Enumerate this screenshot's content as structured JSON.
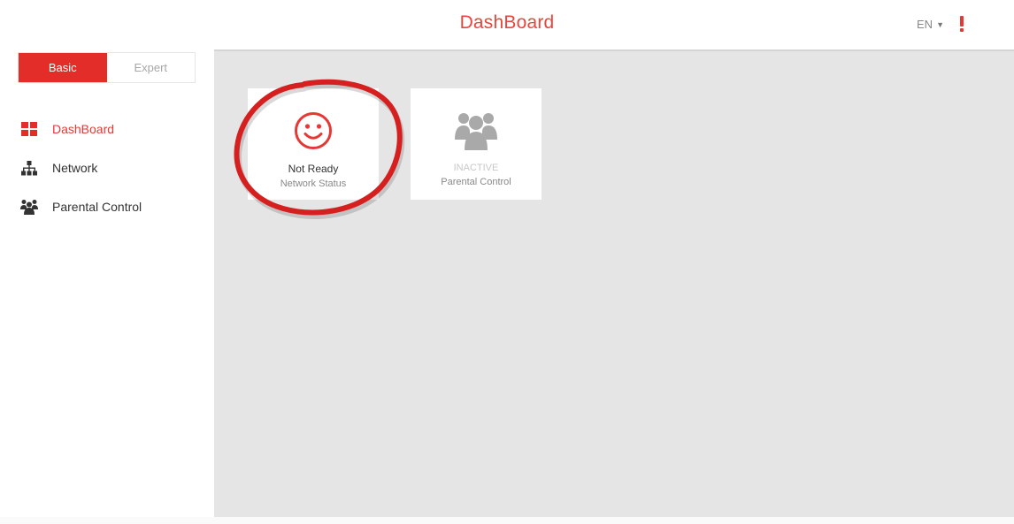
{
  "header": {
    "title": "DashBoard",
    "language": "EN",
    "alert_icon": "exclamation-icon",
    "accent_color": "#e53935"
  },
  "sidebar": {
    "modes": [
      {
        "label": "Basic",
        "active": true
      },
      {
        "label": "Expert",
        "active": false
      }
    ],
    "items": [
      {
        "label": "DashBoard",
        "icon": "dashboard-grid-icon",
        "active": true
      },
      {
        "label": "Network",
        "icon": "network-icon",
        "active": false
      },
      {
        "label": "Parental Control",
        "icon": "parental-control-icon",
        "active": false
      }
    ]
  },
  "tiles": [
    {
      "status": "Not Ready",
      "caption": "Network Status",
      "icon": "smiley-icon"
    },
    {
      "status": "INACTIVE",
      "caption": "Parental Control",
      "icon": "group-users-icon"
    }
  ],
  "colors": {
    "accent": "#e53935",
    "content_background": "#e5e5e5",
    "annotation_circle": "#d61f1f"
  }
}
